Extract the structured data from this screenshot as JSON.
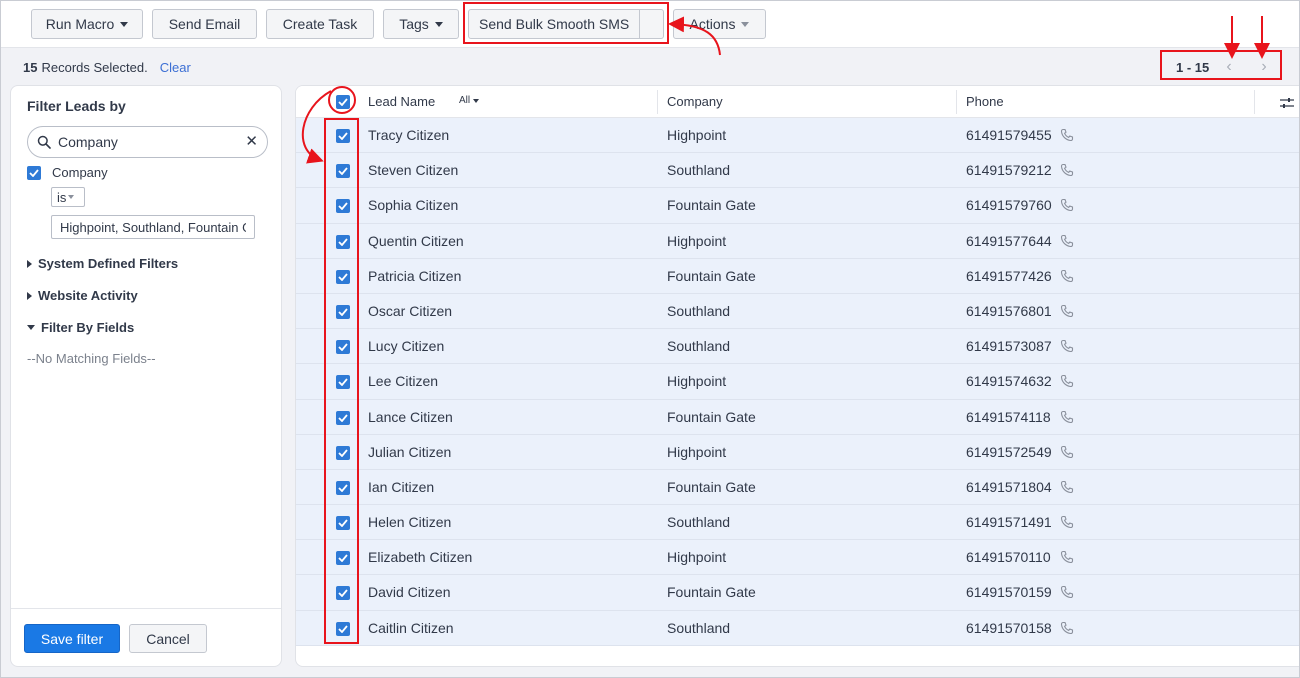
{
  "toolbar": {
    "run_macro": "Run Macro",
    "send_email": "Send Email",
    "create_task": "Create Task",
    "tags": "Tags",
    "send_bulk_sms": "Send Bulk Smooth SMS",
    "actions": "Actions"
  },
  "selection": {
    "count": "15",
    "label": "Records Selected.",
    "clear": "Clear"
  },
  "pager": {
    "range": "1 - 15",
    "prev_icon": "chevron-left-icon",
    "next_icon": "chevron-right-icon"
  },
  "sidebar": {
    "title": "Filter Leads by",
    "search_value": "Company",
    "filter_label": "Company",
    "operator": "is",
    "filter_value": "Highpoint, Southland, Fountain Gate",
    "sections": {
      "system": "System Defined Filters",
      "website": "Website Activity",
      "fields": "Filter By Fields"
    },
    "no_match": "--No Matching Fields--",
    "save": "Save filter",
    "cancel": "Cancel"
  },
  "table": {
    "headers": {
      "lead_name": "Lead Name",
      "all_filter": "All",
      "company": "Company",
      "phone": "Phone"
    },
    "rows": [
      {
        "name": "Tracy Citizen",
        "company": "Highpoint",
        "phone": "61491579455"
      },
      {
        "name": "Steven Citizen",
        "company": "Southland",
        "phone": "61491579212"
      },
      {
        "name": "Sophia Citizen",
        "company": "Fountain Gate",
        "phone": "61491579760"
      },
      {
        "name": "Quentin Citizen",
        "company": "Highpoint",
        "phone": "61491577644"
      },
      {
        "name": "Patricia Citizen",
        "company": "Fountain Gate",
        "phone": "61491577426"
      },
      {
        "name": "Oscar Citizen",
        "company": "Southland",
        "phone": "61491576801"
      },
      {
        "name": "Lucy Citizen",
        "company": "Southland",
        "phone": "61491573087"
      },
      {
        "name": "Lee Citizen",
        "company": "Highpoint",
        "phone": "61491574632"
      },
      {
        "name": "Lance Citizen",
        "company": "Fountain Gate",
        "phone": "61491574118"
      },
      {
        "name": "Julian Citizen",
        "company": "Highpoint",
        "phone": "61491572549"
      },
      {
        "name": "Ian Citizen",
        "company": "Fountain Gate",
        "phone": "61491571804"
      },
      {
        "name": "Helen Citizen",
        "company": "Southland",
        "phone": "61491571491"
      },
      {
        "name": "Elizabeth Citizen",
        "company": "Highpoint",
        "phone": "61491570110"
      },
      {
        "name": "David Citizen",
        "company": "Fountain Gate",
        "phone": "61491570159"
      },
      {
        "name": "Caitlin Citizen",
        "company": "Southland",
        "phone": "61491570158"
      }
    ]
  },
  "colors": {
    "accent": "#1a79e5",
    "checkbox": "#2e7ad6",
    "row_selected": "#ebf1fb",
    "annotation": "#e8141c"
  }
}
